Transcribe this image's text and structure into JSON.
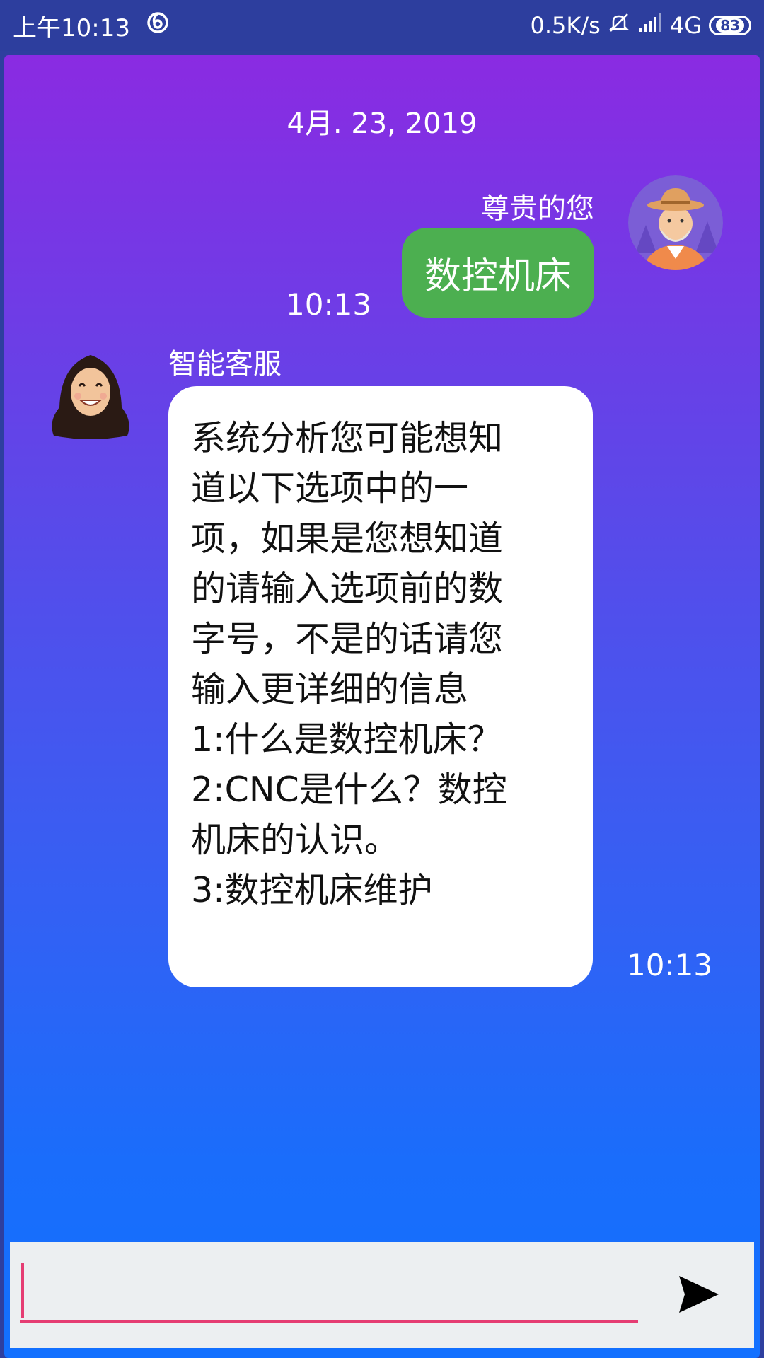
{
  "status_bar": {
    "time": "上午10:13",
    "net_speed": "0.5K/s",
    "network_type": "4G",
    "battery": "83"
  },
  "chat": {
    "date": "4月. 23, 2019",
    "outgoing": {
      "sender": "尊贵的您",
      "text": "数控机床",
      "time": "10:13",
      "bubble_color": "#4caf50"
    },
    "incoming": {
      "sender": "智能客服",
      "lines": [
        "系统分析您可能想知",
        "道以下选项中的一",
        "项，如果是您想知道",
        "的请输入选项前的数",
        "字号，不是的话请您",
        "输入更详细的信息",
        "1:什么是数控机床？",
        "2:CNC是什么？数控",
        "机床的认识。",
        "3:数控机床维护"
      ],
      "time": "10:13"
    }
  },
  "input": {
    "value": "",
    "placeholder": "",
    "underline_color": "#e53d73",
    "send_icon": "send-icon"
  },
  "colors": {
    "status_bar": "#2d3e9e",
    "gradient_top": "#8a2be2",
    "gradient_bottom": "#1270ff"
  }
}
